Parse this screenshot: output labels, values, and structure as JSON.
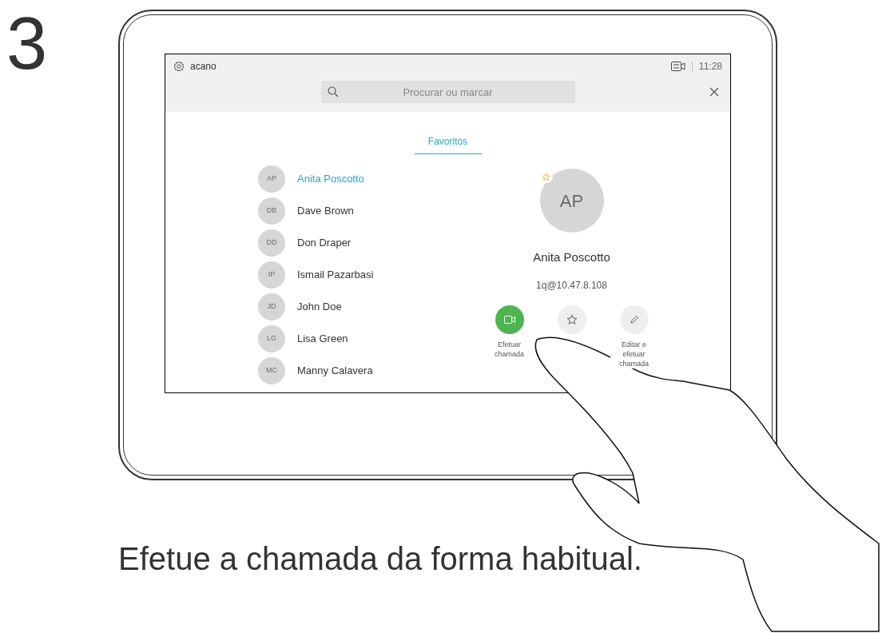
{
  "step": "3",
  "status_bar": {
    "system_name": "acano",
    "time": "11:28"
  },
  "search": {
    "placeholder": "Procurar ou marcar"
  },
  "tabs": [
    {
      "label": "Favoritos",
      "selected": true
    }
  ],
  "contacts": [
    {
      "initials": "AP",
      "name": "Anita Poscotto",
      "selected": true
    },
    {
      "initials": "DB",
      "name": "Dave Brown",
      "selected": false
    },
    {
      "initials": "DD",
      "name": "Don Draper",
      "selected": false
    },
    {
      "initials": "IP",
      "name": "Ismail Pazarbasi",
      "selected": false
    },
    {
      "initials": "JD",
      "name": "John Doe",
      "selected": false
    },
    {
      "initials": "LG",
      "name": "Lisa Green",
      "selected": false
    },
    {
      "initials": "MC",
      "name": "Manny Calavera",
      "selected": false
    }
  ],
  "detail": {
    "initials": "AP",
    "favorite": true,
    "name": "Anita Poscotto",
    "address": "1q@10.47.8.108",
    "actions": [
      {
        "kind": "call",
        "label": "Efetuar chamada"
      },
      {
        "kind": "favorite"
      },
      {
        "kind": "edit",
        "label": "Editar e efetuar chamada"
      }
    ]
  },
  "caption": "Efetue a chamada da forma habitual."
}
